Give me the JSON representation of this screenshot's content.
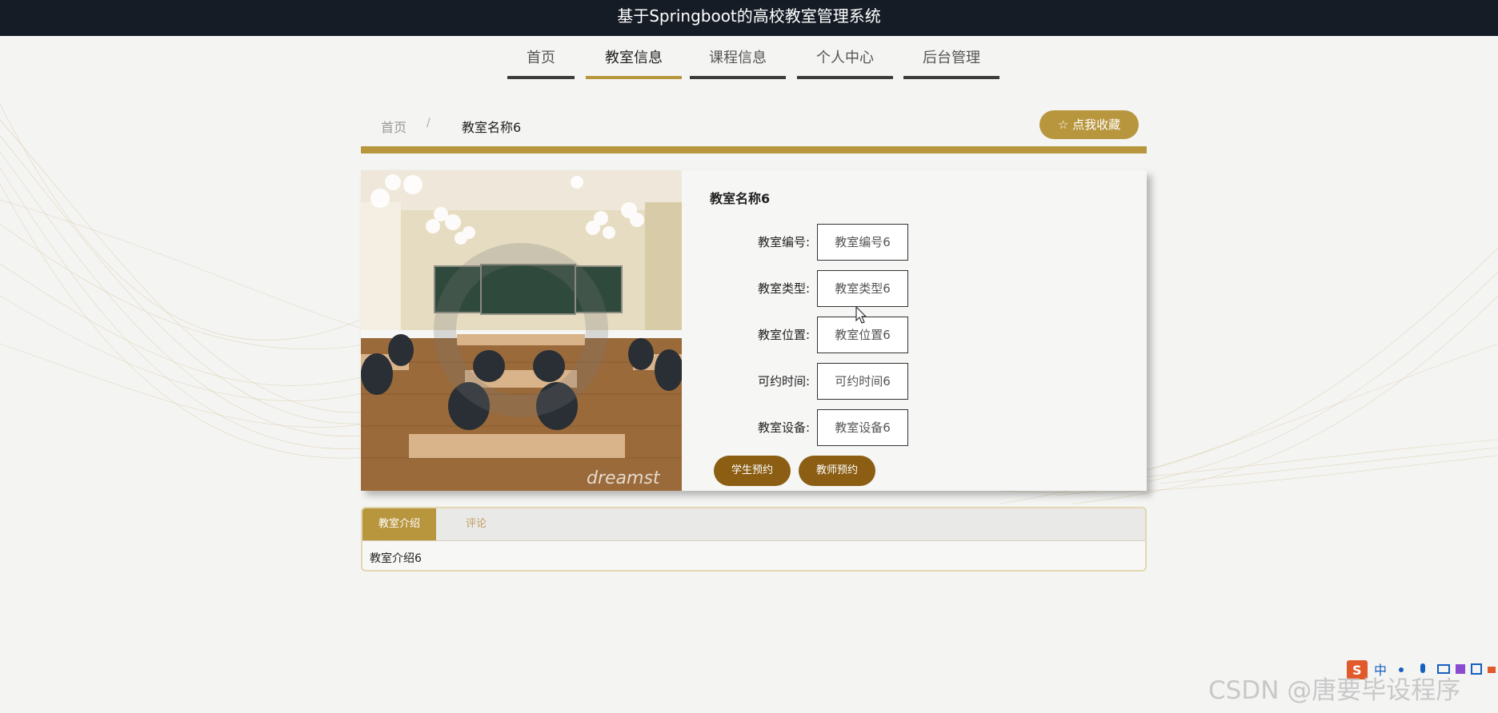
{
  "header": {
    "title": "基于Springboot的高校教室管理系统"
  },
  "nav": {
    "items": [
      "首页",
      "教室信息",
      "课程信息",
      "个人中心",
      "后台管理"
    ],
    "active": "教室信息"
  },
  "breadcrumb": {
    "home": "首页",
    "separator": "/",
    "current": "教室名称6"
  },
  "favorite_button": {
    "icon": "star-outline-icon",
    "label": "点我收藏"
  },
  "detail": {
    "title": "教室名称6",
    "image_watermark": "dreamst",
    "fields": [
      {
        "label": "教室编号:",
        "value": "教室编号6"
      },
      {
        "label": "教室类型:",
        "value": "教室类型6"
      },
      {
        "label": "教室位置:",
        "value": "教室位置6"
      },
      {
        "label": "可约时间:",
        "value": "可约时间6"
      },
      {
        "label": "教室设备:",
        "value": "教室设备6"
      }
    ],
    "buttons": {
      "student": "学生预约",
      "teacher": "教师预约"
    }
  },
  "tabs": {
    "items": [
      "教室介绍",
      "评论"
    ],
    "active": "教室介绍",
    "content": "教室介绍6"
  },
  "ime_toolbar": {
    "mode": "中",
    "logo": "S"
  },
  "watermark": "CSDN @唐要毕设程序",
  "colors": {
    "topbar": "#151c26",
    "accent_gold": "#b8963e",
    "action_brown": "#8b5e14",
    "nav_underline": "#3c3c3c"
  }
}
